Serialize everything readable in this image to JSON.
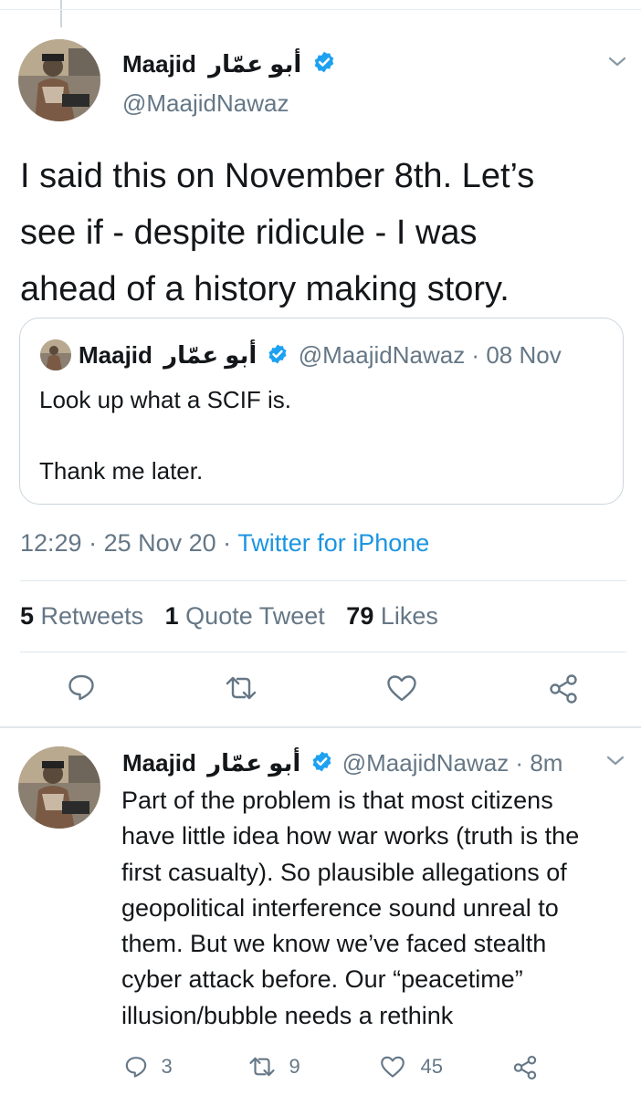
{
  "tweet": {
    "name": "Maajid",
    "name_arabic": "أبو عمّار",
    "handle": "@MaajidNawaz",
    "text_lines": [
      "I said this on November 8th. Let’s",
      "see if - despite ridicule - I was",
      "ahead of a history making story."
    ],
    "quoted": {
      "name": "Maajid",
      "name_arabic": "أبو عمّار",
      "handle_time": "@MaajidNawaz · 08 Nov",
      "line1": "Look up what a SCIF is.",
      "line2": "Thank me later."
    },
    "time": "12:29",
    "date": "· 25 Nov 20 ·",
    "source": "Twitter for iPhone",
    "stats": {
      "retweets_count": "5",
      "retweets_label": "Retweets",
      "quotes_count": "1",
      "quotes_label": "Quote Tweet",
      "likes_count": "79",
      "likes_label": "Likes"
    }
  },
  "reply": {
    "name": "Maajid",
    "name_arabic": "أبو عمّار",
    "handle_time": "@MaajidNawaz · 8m",
    "text_lines": [
      "Part of the problem is that most citizens",
      "have little idea how war works (truth is the",
      "first casualty). So plausible allegations of",
      "geopolitical interference sound unreal to",
      "them. But we know we’ve faced stealth",
      "cyber attack before. Our “peacetime”",
      "illusion/bubble needs a rethink"
    ],
    "reply_count": "3",
    "retweet_count": "9",
    "like_count": "45"
  },
  "colors": {
    "accent": "#1b95e0",
    "muted": "#657786",
    "text": "#14171a",
    "border": "#e1e8ed"
  },
  "icons": [
    "verified-badge-icon",
    "chevron-down-icon",
    "reply-icon",
    "retweet-icon",
    "like-icon",
    "share-icon"
  ]
}
